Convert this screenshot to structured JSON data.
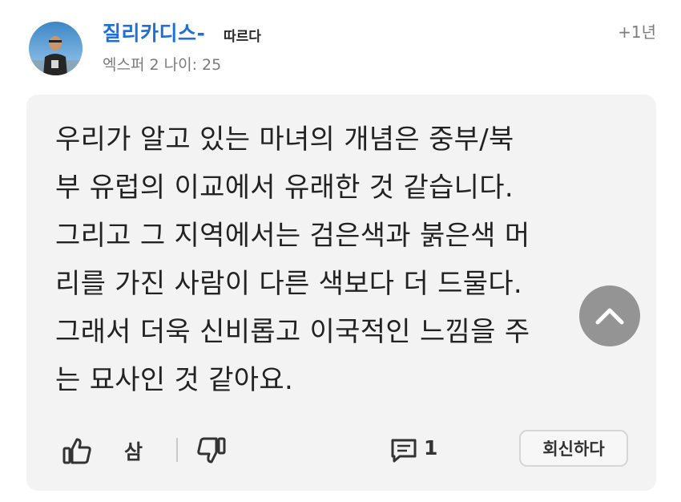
{
  "header": {
    "username": "질리카디스-",
    "follow_label": "따르다",
    "timestamp": "+1년",
    "meta": "엑스퍼 2 나이: 25"
  },
  "comment": {
    "lines": [
      "우리가 알고 있는 마녀의 개념은 중부/북",
      "부 유럽의 이교에서 유래한 것 같습니다.",
      "그리고 그 지역에서는 검은색과 붉은색 머",
      "리를 가진 사람이 다른 색보다 더 드물다.",
      "그래서 더욱 신비롭고 이국적인 느낌을 주",
      "는 묘사인 것 같아요."
    ]
  },
  "actions": {
    "vote_count": "삼",
    "reply_count": "1",
    "reply_button_label": "회신하다"
  },
  "icons": {
    "upvote": "thumbs-up-icon",
    "downvote": "thumbs-down-icon",
    "replies": "comment-bubble-icon",
    "scroll_top": "chevron-up-icon"
  },
  "colors": {
    "username": "#1f6fd6",
    "card_background": "#f3f3f3"
  }
}
